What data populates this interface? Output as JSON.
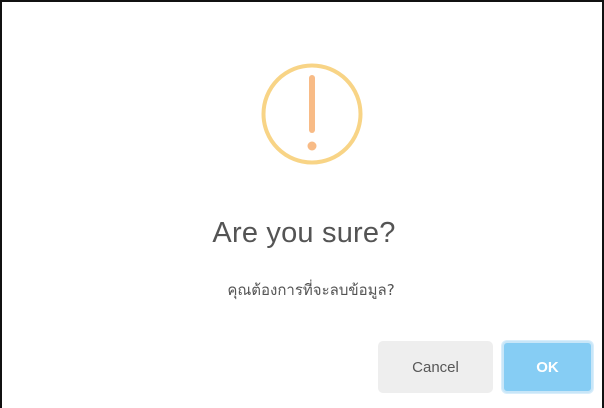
{
  "dialog": {
    "title": "Are you sure?",
    "message": "คุณต้องการที่จะลบข้อมูล?",
    "icon": "warning-exclamation-icon",
    "icon_color": "#f8d486",
    "icon_mark_color": "#f8bb86",
    "cancel_label": "Cancel",
    "ok_label": "OK",
    "ok_color": "#86cdf4",
    "cancel_color": "#eeeeee"
  }
}
